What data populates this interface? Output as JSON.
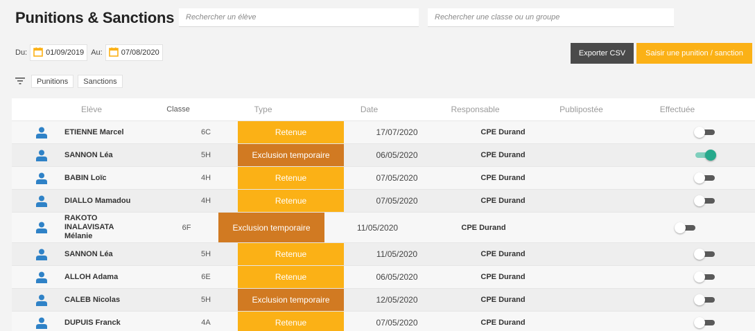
{
  "page": {
    "title": "Punitions & Sanctions"
  },
  "search": {
    "student_placeholder": "Rechercher un élève",
    "class_placeholder": "Rechercher une classe ou un groupe"
  },
  "dates": {
    "from_label": "Du:",
    "from_value": "01/09/2019",
    "to_label": "Au:",
    "to_value": "07/08/2020"
  },
  "actions": {
    "export_label": "Exporter CSV",
    "add_label": "Saisir une punition / sanction"
  },
  "filters": {
    "chips": [
      "Punitions",
      "Sanctions"
    ]
  },
  "colors": {
    "retenue": "#fbb116",
    "exclusion": "#d17a22",
    "toggle_on": "#26a98c",
    "export": "#4a4a4a",
    "user_icon": "#2f82c7"
  },
  "table": {
    "headers": [
      "Elève",
      "Classe",
      "Type",
      "Date",
      "Responsable",
      "Publipostée",
      "Effectuée"
    ],
    "rows": [
      {
        "name": "ETIENNE Marcel",
        "class": "6C",
        "type": "Retenue",
        "date": "17/07/2020",
        "responsible": "CPE Durand",
        "done": false
      },
      {
        "name": "SANNON Léa",
        "class": "5H",
        "type": "Exclusion temporaire",
        "date": "06/05/2020",
        "responsible": "CPE Durand",
        "done": true
      },
      {
        "name": "BABIN Loïc",
        "class": "4H",
        "type": "Retenue",
        "date": "07/05/2020",
        "responsible": "CPE Durand",
        "done": false
      },
      {
        "name": "DIALLO Mamadou",
        "class": "4H",
        "type": "Retenue",
        "date": "07/05/2020",
        "responsible": "CPE Durand",
        "done": false
      },
      {
        "name": "RAKOTO INALAVISATA Mélanie",
        "class": "6F",
        "type": "Exclusion temporaire",
        "date": "11/05/2020",
        "responsible": "CPE Durand",
        "done": false
      },
      {
        "name": "SANNON Léa",
        "class": "5H",
        "type": "Retenue",
        "date": "11/05/2020",
        "responsible": "CPE Durand",
        "done": false
      },
      {
        "name": "ALLOH Adama",
        "class": "6E",
        "type": "Retenue",
        "date": "06/05/2020",
        "responsible": "CPE Durand",
        "done": false
      },
      {
        "name": "CALEB Nicolas",
        "class": "5H",
        "type": "Exclusion temporaire",
        "date": "12/05/2020",
        "responsible": "CPE Durand",
        "done": false
      },
      {
        "name": "DUPUIS Franck",
        "class": "4A",
        "type": "Retenue",
        "date": "07/05/2020",
        "responsible": "CPE Durand",
        "done": false
      }
    ]
  }
}
